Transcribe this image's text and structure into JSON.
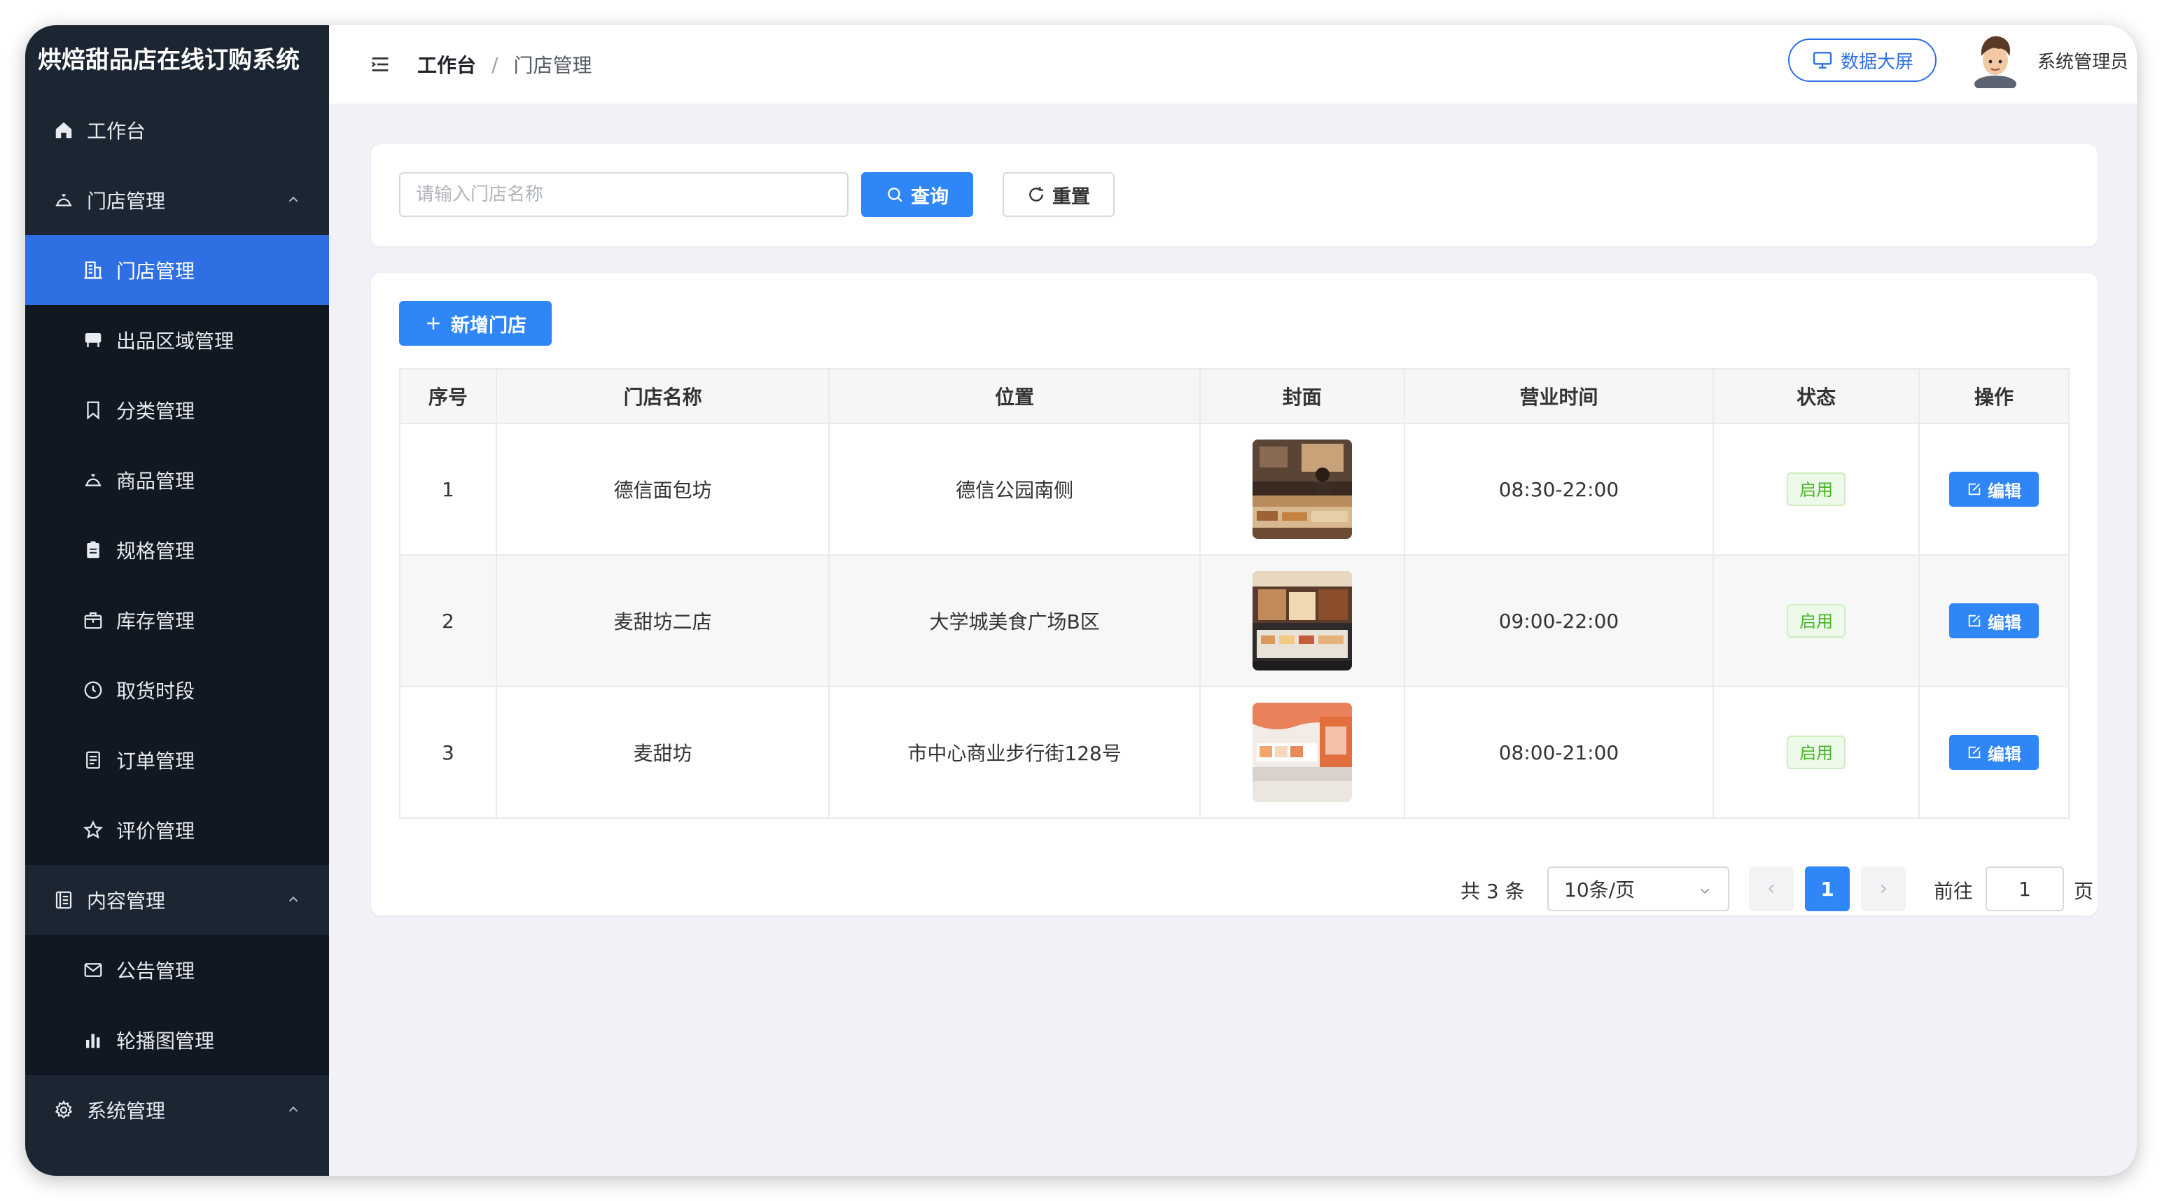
{
  "app": {
    "title": "烘焙甜品店在线订购系统"
  },
  "sidebar": {
    "items": [
      {
        "label": "工作台"
      },
      {
        "label": "门店管理"
      },
      {
        "label": "门店管理"
      },
      {
        "label": "出品区域管理"
      },
      {
        "label": "分类管理"
      },
      {
        "label": "商品管理"
      },
      {
        "label": "规格管理"
      },
      {
        "label": "库存管理"
      },
      {
        "label": "取货时段"
      },
      {
        "label": "订单管理"
      },
      {
        "label": "评价管理"
      },
      {
        "label": "内容管理"
      },
      {
        "label": "公告管理"
      },
      {
        "label": "轮播图管理"
      },
      {
        "label": "系统管理"
      }
    ]
  },
  "header": {
    "breadcrumb": [
      "工作台",
      "/",
      "门店管理"
    ],
    "screen_button": "数据大屏",
    "user_name": "系统管理员"
  },
  "search": {
    "placeholder": "请输入门店名称",
    "value": "",
    "query_label": "查询",
    "reset_label": "重置"
  },
  "toolbar": {
    "add_label": "新增门店"
  },
  "table": {
    "columns": [
      "序号",
      "门店名称",
      "位置",
      "封面",
      "营业时间",
      "状态",
      "操作"
    ],
    "rows": [
      {
        "index": "1",
        "name": "德信面包坊",
        "location": "德信公园南侧",
        "hours": "08:30-22:00",
        "status": "启用",
        "action": "编辑"
      },
      {
        "index": "2",
        "name": "麦甜坊二店",
        "location": "大学城美食广场B区",
        "hours": "09:00-22:00",
        "status": "启用",
        "action": "编辑"
      },
      {
        "index": "3",
        "name": "麦甜坊",
        "location": "市中心商业步行街128号",
        "hours": "08:00-21:00",
        "status": "启用",
        "action": "编辑"
      }
    ]
  },
  "pagination": {
    "total_text": "共 3 条",
    "page_size": "10条/页",
    "current_page": "1",
    "goto_label": "前往",
    "goto_value": "1",
    "goto_suffix": "页"
  },
  "colors": {
    "sidebar_bg": "#1c2532",
    "sidebar_active": "#2f6fe4",
    "primary": "#2f86f6",
    "status_green": "#49b52b"
  }
}
